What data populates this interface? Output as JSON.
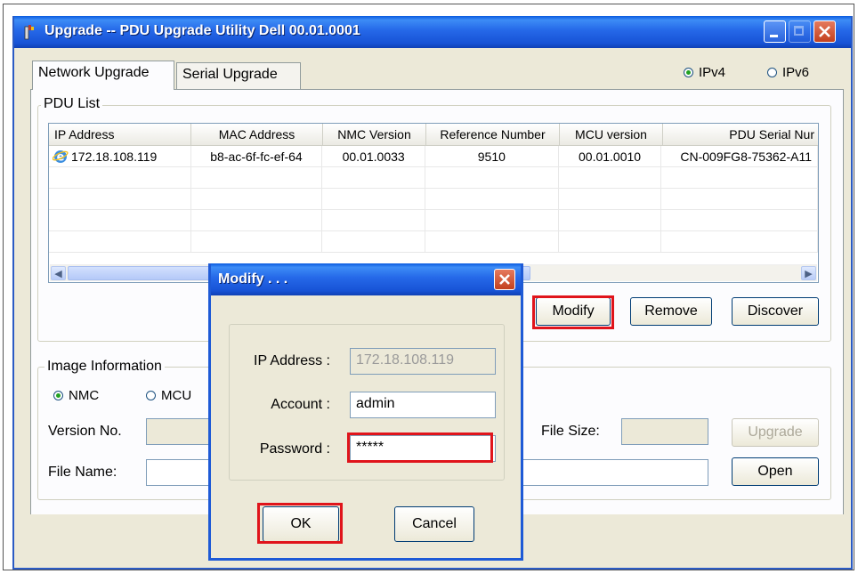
{
  "window": {
    "title": "Upgrade -- PDU Upgrade Utility Dell 00.01.0001",
    "accent_color": "#2568e8"
  },
  "tabs": [
    {
      "label": "Network Upgrade",
      "active": true
    },
    {
      "label": "Serial Upgrade",
      "active": false
    }
  ],
  "ip_mode": {
    "options": [
      {
        "label": "IPv4",
        "selected": true
      },
      {
        "label": "IPv6",
        "selected": false
      }
    ]
  },
  "pdu_list": {
    "title": "PDU List",
    "columns": [
      "IP Address",
      "MAC Address",
      "NMC Version",
      "Reference Number",
      "MCU version",
      "PDU Serial Nur"
    ],
    "rows": [
      [
        "172.18.108.119",
        "b8-ac-6f-fc-ef-64",
        "00.01.0033",
        "9510",
        "00.01.0010",
        "CN-009FG8-75362-A11"
      ]
    ],
    "row_icon": "ie-globe-icon"
  },
  "buttons": {
    "modify": "Modify",
    "remove": "Remove",
    "discover": "Discover",
    "upgrade": "Upgrade",
    "open": "Open"
  },
  "image_info": {
    "title": "Image Information",
    "options": [
      {
        "label": "NMC",
        "selected": true
      },
      {
        "label": "MCU",
        "selected": false
      }
    ],
    "version_label": "Version No.",
    "file_name_label": "File Name:",
    "file_size_label": "File Size:"
  },
  "modify_dialog": {
    "title": "Modify . . .",
    "ip_label": "IP Address :",
    "ip_value": "172.18.108.119",
    "account_label": "Account :",
    "account_value": "admin",
    "password_label": "Password :",
    "password_value": "*****",
    "ok_label": "OK",
    "cancel_label": "Cancel"
  },
  "highlight_color": "#e0141b"
}
